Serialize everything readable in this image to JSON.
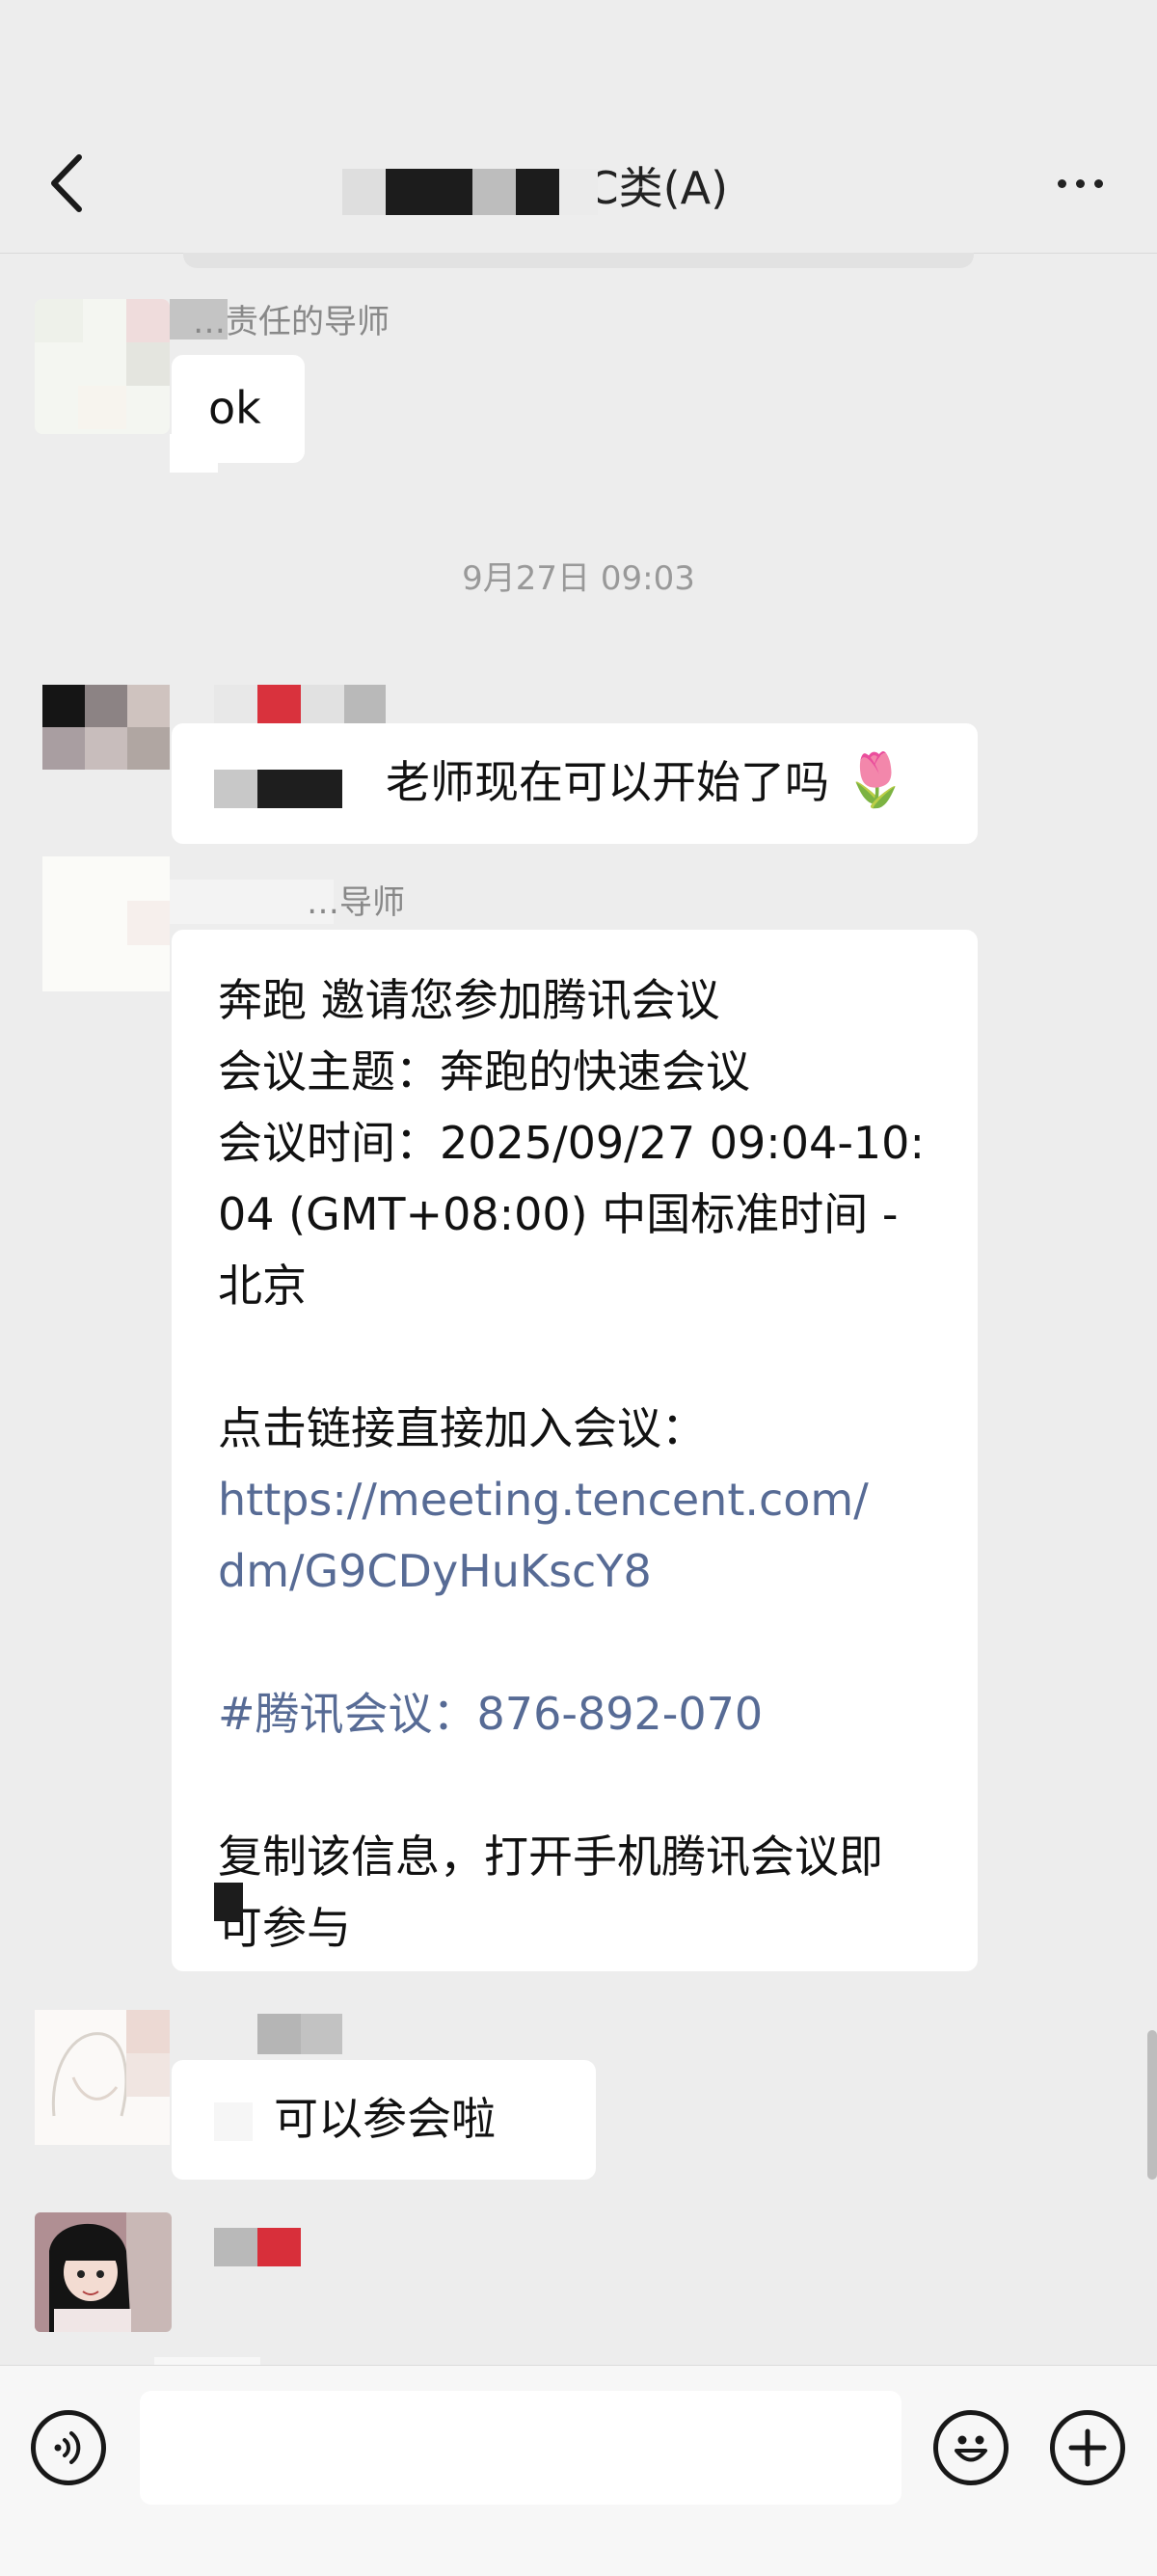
{
  "header": {
    "title": "…ICSE C类(A)",
    "back_icon": "chevron-left-icon",
    "more_icon": "more-dots-icon"
  },
  "messages": [
    {
      "sender": "…责任的导师",
      "text": "ok"
    },
    {
      "timestamp": "9月27日 09:03"
    },
    {
      "sender": "",
      "text": "老师现在可以开始了吗",
      "emoji": "🌷"
    },
    {
      "sender": "…导师",
      "lines": [
        "奔跑 邀请您参加腾讯会议",
        "会议主题：奔跑的快速会议",
        "会议时间：2025/09/27 09:04-10:",
        "04 (GMT+08:00) 中国标准时间 -",
        "北京",
        "",
        "点击链接直接加入会议：",
        "https://meeting.tencent.com/",
        "dm/G9CDyHuKscY8",
        "",
        "#腾讯会议：876-892-070",
        "",
        "复制该信息，打开手机腾讯会议即",
        "可参与"
      ]
    },
    {
      "sender": "",
      "text": "，可以参会啦"
    },
    {
      "sender": "",
      "text": ""
    }
  ],
  "input_bar": {
    "voice_icon": "voice-icon",
    "emoji_icon": "emoji-smile-icon",
    "add_icon": "plus-icon",
    "input_value": ""
  },
  "colors": {
    "background": "#ededed",
    "bubble": "#ffffff",
    "link": "#576b95",
    "timestamp": "#999999"
  }
}
